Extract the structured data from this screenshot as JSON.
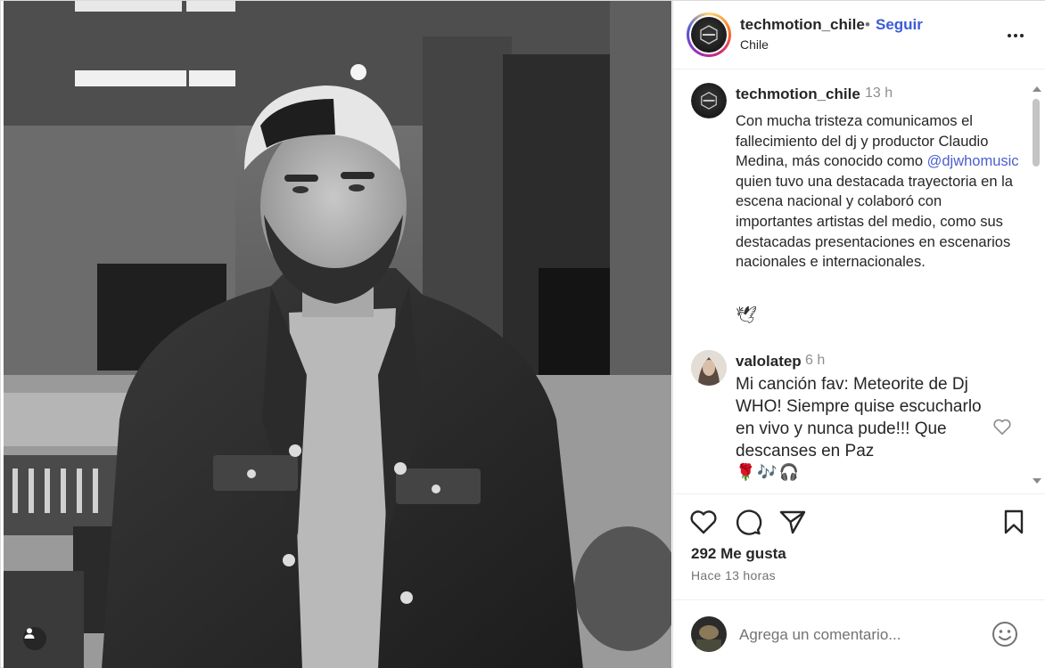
{
  "post": {
    "account": "techmotion_chile",
    "separator": "•",
    "follow_label": "Seguir",
    "location": "Chile",
    "likes": "292 Me gusta",
    "time_ago": "Hace 13 horas"
  },
  "caption": {
    "user": "techmotion_chile",
    "time": "13 h",
    "text_before": "Con mucha tristeza comunicamos el fallecimiento del dj y productor Claudio Medina, más conocido como ",
    "mention": "@djwhomusic",
    "text_after": " quien tuvo una destacada trayectoria en la escena nacional y colaboró con importantes artistas del medio, como sus destacadas presentaciones en escenarios nacionales e internacionales.",
    "emoji": "🕊"
  },
  "comment": {
    "user": "valolatep",
    "time": "6 h",
    "text": "Mi canción fav: Meteorite de Dj WHO! Siempre quise escucharlo en vivo y nunca pude!!! Que descanses en Paz",
    "emojis": "🌹🎶🎧"
  },
  "add_comment": {
    "placeholder": "Agrega un comentario..."
  },
  "icons": {
    "more": "more-options-icon",
    "like": "heart-icon",
    "comment": "comment-icon",
    "share": "send-icon",
    "save": "bookmark-icon",
    "emoji": "emoji-icon",
    "tag": "user-tag-icon"
  },
  "colors": {
    "follow": "#3b5bd9",
    "mention": "#4a5fd0",
    "muted": "#737373"
  }
}
